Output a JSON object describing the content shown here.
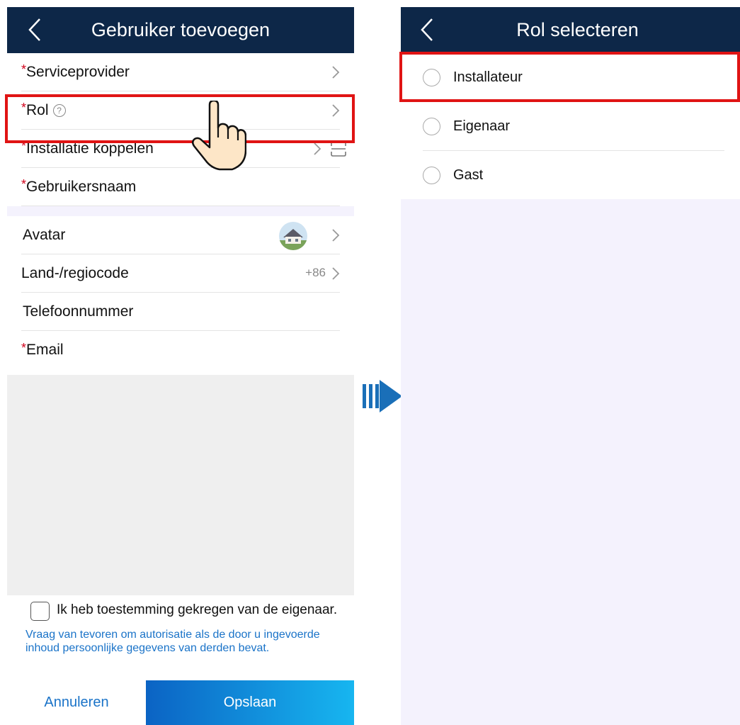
{
  "left_screen": {
    "title": "Gebruiker toevoegen",
    "rows": [
      {
        "label": "Serviceprovider",
        "required": "*"
      },
      {
        "label": "Rol",
        "required": "*",
        "help_icon": "question-circle-icon"
      },
      {
        "label": "Installatie koppelen",
        "required": "*"
      },
      {
        "label": "Gebruikersnaam",
        "required": "*"
      }
    ],
    "profile_rows": [
      {
        "label": "Avatar"
      },
      {
        "label": "Land-/regiocode",
        "value": "+86"
      },
      {
        "label": "Telefoonnummer"
      },
      {
        "label": "Email",
        "required": "*"
      }
    ],
    "consent_label": "Ik heb toestemming gekregen van de eigenaar.",
    "consent_hint": "Vraag van tevoren om autorisatie als de door u ingevoerde inhoud persoonlijke gegevens van derden bevat.",
    "cancel_label": "Annuleren",
    "save_label": "Opslaan",
    "help_glyph": "?"
  },
  "right_screen": {
    "title": "Rol selecteren",
    "options": [
      {
        "label": "Installateur"
      },
      {
        "label": "Eigenaar"
      },
      {
        "label": "Gast"
      }
    ]
  },
  "colors": {
    "titlebar": "#0d2748",
    "required": "#d0021b",
    "link": "#1a73c8",
    "highlight": "#e01414",
    "arrow": "#1a6fb8"
  },
  "icons": [
    "back-arrow-icon",
    "chevron-right-icon",
    "question-circle-icon",
    "scan-icon",
    "pointing-hand-icon",
    "forward-arrow-icon",
    "radio-icon"
  ]
}
